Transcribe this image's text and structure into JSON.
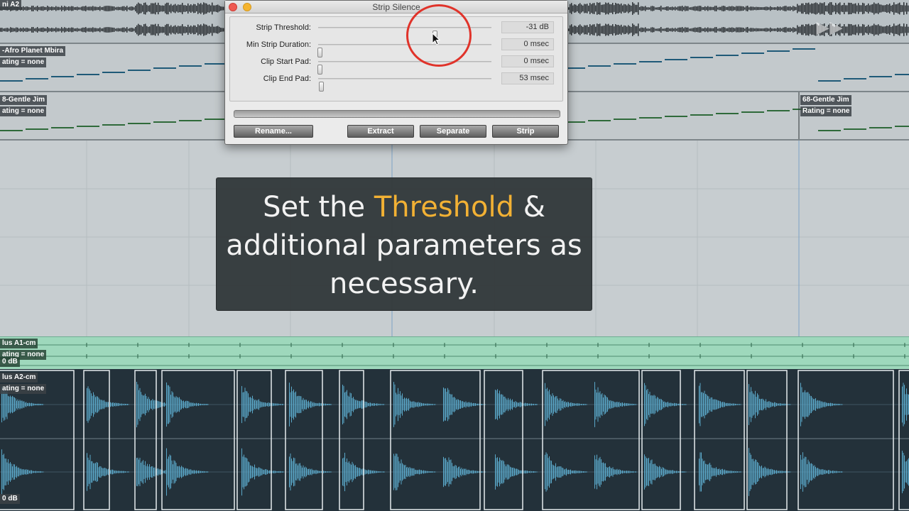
{
  "dialog": {
    "title": "Strip Silence",
    "params": [
      {
        "label": "Strip Threshold:",
        "value": "-31 dB",
        "level": 0.68
      },
      {
        "label": "Min Strip Duration:",
        "value": "0 msec",
        "level": 0.0
      },
      {
        "label": "Clip Start Pad:",
        "value": "0 msec",
        "level": 0.0
      },
      {
        "label": "Clip End Pad:",
        "value": "53 msec",
        "level": 0.01
      }
    ],
    "buttons": {
      "rename": "Rename...",
      "extract": "Extract",
      "separate": "Separate",
      "strip": "Strip"
    }
  },
  "caption": {
    "pre": "Set the ",
    "highlight": "Threshold",
    "post": " & additional parameters as necessary."
  },
  "tracks": {
    "top_label": "ni A2",
    "track2_label": "-Afro Planet Mbira",
    "track2_rating": "ating = none",
    "track3_label": "8-Gentle Jim",
    "track3_rating": "ating = none",
    "track3b_label": "68-Gentle Jim",
    "track3b_rating": "Rating = none",
    "track4_label": "lus A1-cm",
    "track4_rating": "ating = none",
    "track4_db": "0 dB",
    "track5_label": "lus A2-cm",
    "track5_rating": "ating = none",
    "track5_db": "0 dB"
  },
  "colors": {
    "accent": "#f2b134",
    "highlight_circle": "#e0332a",
    "waveform": "#5aa7c8",
    "green_lane": "#9ed8bc"
  }
}
